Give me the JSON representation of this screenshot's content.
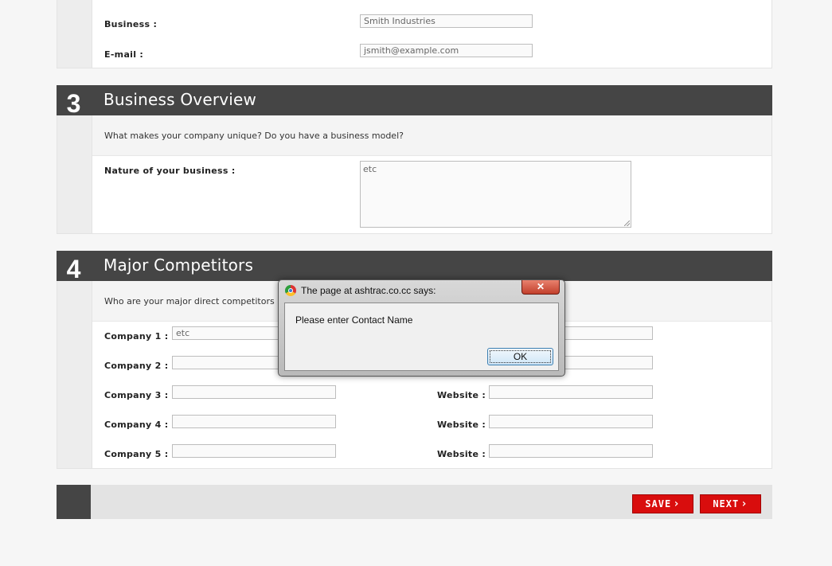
{
  "section2": {
    "business_label": "Business :",
    "business_value": "Smith Industries",
    "email_label": "E-mail :",
    "email_value": "jsmith@example.com"
  },
  "section3": {
    "number": "3",
    "title": "Business Overview",
    "intro": "What makes your company unique? Do you have a business model?",
    "nature_label": "Nature of your business :",
    "nature_value": "etc"
  },
  "section4": {
    "number": "4",
    "title": "Major Competitors",
    "intro": "Who are your major direct competitors",
    "company_labels": [
      "Company 1 :",
      "Company 2 :",
      "Company 3 :",
      "Company 4 :",
      "Company 5 :"
    ],
    "company_values": [
      "etc",
      "",
      "",
      "",
      ""
    ],
    "website_label": "Website :"
  },
  "footer": {
    "save_label": "SAVE",
    "next_label": "NEXT"
  },
  "dialog": {
    "title": "The page at ashtrac.co.cc says:",
    "message": "Please enter Contact Name",
    "ok_label": "OK",
    "close_glyph": "✕"
  }
}
